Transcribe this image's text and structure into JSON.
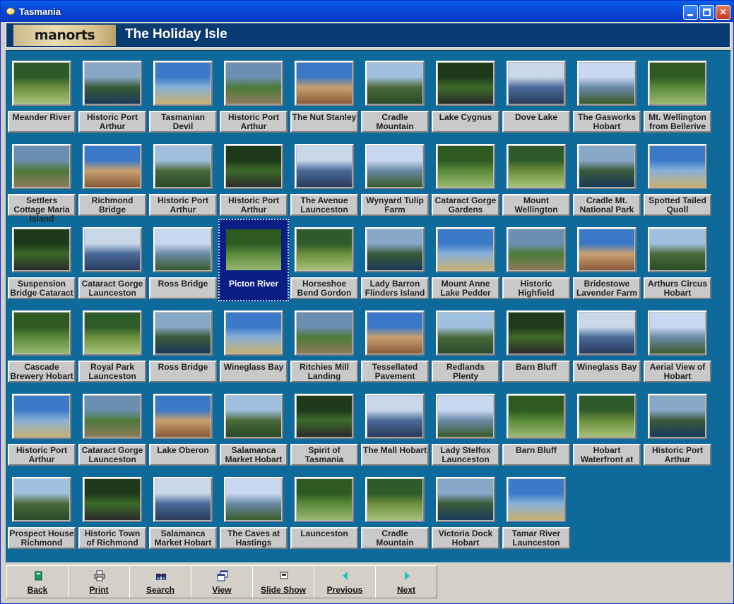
{
  "window": {
    "title": "Tasmania",
    "minimize": "_",
    "maximize": "□",
    "close": "✕"
  },
  "header": {
    "logo_text": "manorts images",
    "title": "The Holiday Isle"
  },
  "colors": {
    "background": "#0d6a9b",
    "header": "#0a3a72",
    "label": "#c9c9c9",
    "selected": "#0a1e85"
  },
  "selected_index": 23,
  "tiles": [
    {
      "label": "Meander River"
    },
    {
      "label": "Historic Port Arthur"
    },
    {
      "label": "Tasmanian Devil"
    },
    {
      "label": "Historic Port Arthur"
    },
    {
      "label": "The Nut Stanley"
    },
    {
      "label": "Cradle Mountain"
    },
    {
      "label": "Lake Cygnus"
    },
    {
      "label": "Dove Lake"
    },
    {
      "label": "The Gasworks Hobart"
    },
    {
      "label": "Mt. Wellington from Bellerive"
    },
    {
      "label": "Settlers Cottage Maria Island"
    },
    {
      "label": "Richmond Bridge"
    },
    {
      "label": "Historic Port Arthur"
    },
    {
      "label": "Historic Port Arthur"
    },
    {
      "label": "The Avenue Launceston"
    },
    {
      "label": "Wynyard Tulip Farm"
    },
    {
      "label": "Cataract Gorge Gardens"
    },
    {
      "label": "Mount Wellington"
    },
    {
      "label": "Cradle Mt. National Park"
    },
    {
      "label": "Spotted Tailed Quoll"
    },
    {
      "label": "Suspension Bridge Cataract"
    },
    {
      "label": "Cataract Gorge Launceston"
    },
    {
      "label": "Ross Bridge"
    },
    {
      "label": "Picton River"
    },
    {
      "label": "Horseshoe Bend Gordon"
    },
    {
      "label": "Lady Barron Flinders Island"
    },
    {
      "label": "Mount Anne Lake Pedder"
    },
    {
      "label": "Historic Highfield"
    },
    {
      "label": "Bridestowe Lavender Farm"
    },
    {
      "label": "Arthurs Circus Hobart"
    },
    {
      "label": "Cascade Brewery Hobart"
    },
    {
      "label": "Royal Park Launceston"
    },
    {
      "label": "Ross Bridge"
    },
    {
      "label": "Wineglass Bay"
    },
    {
      "label": "Ritchies Mill Landing"
    },
    {
      "label": "Tessellated Pavement"
    },
    {
      "label": "Redlands Plenty"
    },
    {
      "label": "Barn Bluff"
    },
    {
      "label": "Wineglass Bay"
    },
    {
      "label": "Aerial View of Hobart"
    },
    {
      "label": "Historic Port Arthur"
    },
    {
      "label": "Cataract Gorge Launceston"
    },
    {
      "label": "Lake Oberon"
    },
    {
      "label": "Salamanca Market Hobart"
    },
    {
      "label": "Spirit of Tasmania"
    },
    {
      "label": "The Mall Hobart"
    },
    {
      "label": "Lady Stelfox Launceston"
    },
    {
      "label": "Barn Bluff"
    },
    {
      "label": "Hobart Waterfront at"
    },
    {
      "label": "Historic Port Arthur"
    },
    {
      "label": "Prospect House Richmond"
    },
    {
      "label": "Historic Town of Richmond"
    },
    {
      "label": "Salamanca Market Hobart"
    },
    {
      "label": "The Caves at Hastings"
    },
    {
      "label": "Launceston"
    },
    {
      "label": "Cradle Mountain"
    },
    {
      "label": "Victoria Dock Hobart"
    },
    {
      "label": "Tamar River Launceston"
    }
  ],
  "toolbar": [
    {
      "label": "Back",
      "icon": "book-icon"
    },
    {
      "label": "Print",
      "icon": "printer-icon"
    },
    {
      "label": "Search",
      "icon": "binoculars-icon"
    },
    {
      "label": "View",
      "icon": "windows-icon"
    },
    {
      "label": "Slide Show",
      "icon": "slideshow-icon"
    },
    {
      "label": "Previous",
      "icon": "arrow-left-icon"
    },
    {
      "label": "Next",
      "icon": "arrow-right-icon"
    }
  ]
}
